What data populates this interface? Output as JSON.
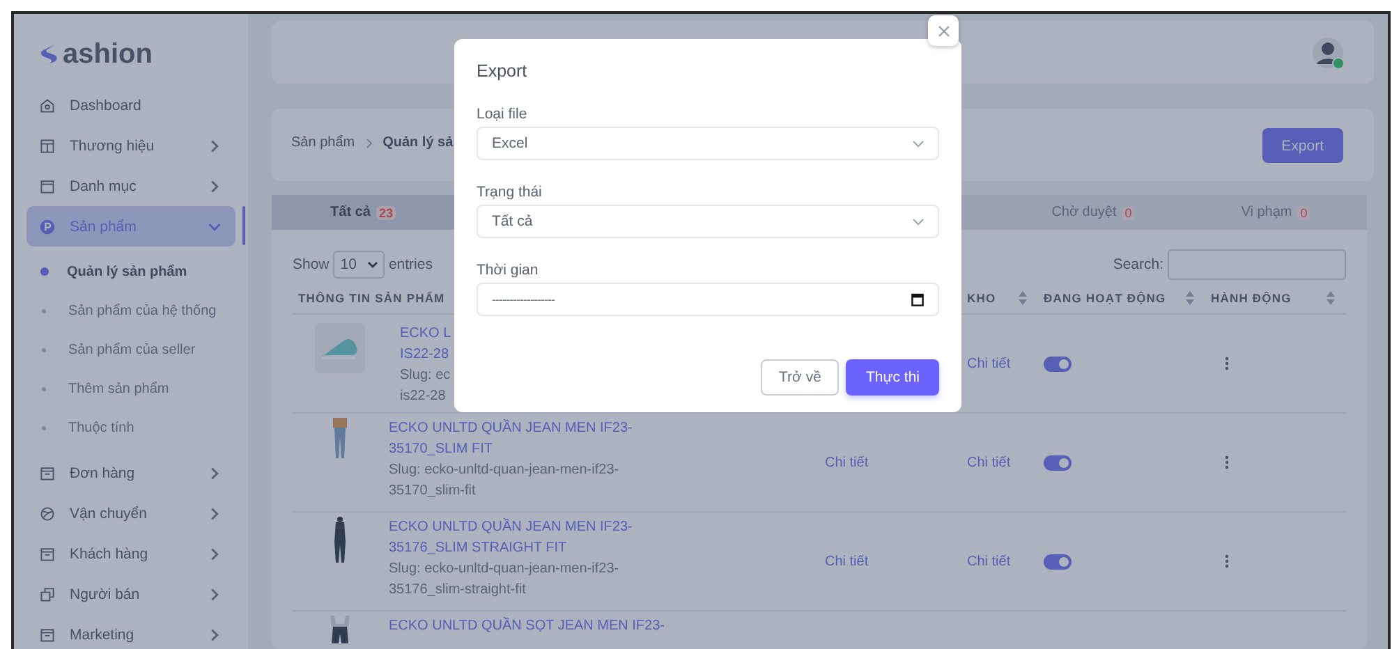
{
  "sidebar": {
    "logo": "ashion",
    "items": [
      {
        "label": "Dashboard",
        "has_submenu": false,
        "expanded": false,
        "selected": false
      },
      {
        "label": "Thương hiệu",
        "has_submenu": true,
        "expanded": false,
        "selected": false
      },
      {
        "label": "Danh mục",
        "has_submenu": true,
        "expanded": false,
        "selected": false
      },
      {
        "label": "Sản phẩm",
        "has_submenu": true,
        "expanded": true,
        "selected": true,
        "children": [
          {
            "label": "Quản lý sản phẩm",
            "selected": true
          },
          {
            "label": "Sản phẩm của hệ thống",
            "selected": false
          },
          {
            "label": "Sản phẩm của seller",
            "selected": false
          },
          {
            "label": "Thêm sản phẩm",
            "selected": false
          },
          {
            "label": "Thuộc tính",
            "selected": false
          }
        ]
      },
      {
        "label": "Đơn hàng",
        "has_submenu": true,
        "expanded": false,
        "selected": false
      },
      {
        "label": "Vận chuyển",
        "has_submenu": true,
        "expanded": false,
        "selected": false
      },
      {
        "label": "Khách hàng",
        "has_submenu": true,
        "expanded": false,
        "selected": false
      },
      {
        "label": "Người bán",
        "has_submenu": true,
        "expanded": false,
        "selected": false
      },
      {
        "label": "Marketing",
        "has_submenu": true,
        "expanded": false,
        "selected": false
      }
    ]
  },
  "breadcrumb": [
    "Sản phẩm",
    "Quản lý sả"
  ],
  "export_button": "Export",
  "tabs": [
    {
      "label": "Tất cả",
      "count": "23",
      "selected": true
    },
    {
      "label": "Chờ duyệt",
      "count": "0",
      "selected": false
    },
    {
      "label": "Vi phạm",
      "count": "0",
      "selected": false
    }
  ],
  "table": {
    "show_label": "Show",
    "page_size": "10",
    "entries_label": "entries",
    "search_label": "Search:",
    "columns": [
      {
        "label": "THÔNG TIN SẢN PHẨM"
      },
      {
        "label": "KHO"
      },
      {
        "label": "ĐANG HOẠT ĐỘNG"
      },
      {
        "label": "HÀNH ĐỘNG"
      }
    ],
    "rows": [
      {
        "title": [
          "ECKO L",
          "IS22-28"
        ],
        "slug": [
          "Slug: ec",
          "is22-28"
        ],
        "stock": "Chi tiết",
        "active": true
      },
      {
        "title": [
          "ECKO UNLTD QUẦN JEAN MEN IF23-",
          "35170_SLIM FIT"
        ],
        "slug": [
          "Slug: ecko-unltd-quan-jean-men-if23-",
          "35170_slim-fit"
        ],
        "detail": "Chi tiết",
        "stock": "Chi tiết",
        "active": true
      },
      {
        "title": [
          "ECKO UNLTD QUẦN JEAN MEN IF23-",
          "35176_SLIM STRAIGHT FIT"
        ],
        "slug": [
          "Slug: ecko-unltd-quan-jean-men-if23-",
          "35176_slim-straight-fit"
        ],
        "detail": "Chi tiết",
        "stock": "Chi tiết",
        "active": true
      },
      {
        "title": [
          "ECKO UNLTD QUẦN SỌT JEAN MEN IF23-"
        ]
      }
    ]
  },
  "modal": {
    "title": "Export",
    "fields": [
      {
        "label": "Loại file",
        "kind": "select",
        "value": "Excel"
      },
      {
        "label": "Trạng thái",
        "kind": "select",
        "value": "Tất cả"
      },
      {
        "label": "Thời gian",
        "kind": "date",
        "value": "------------------"
      }
    ],
    "buttons": [
      {
        "label": "Trở về",
        "kind": "secondary"
      },
      {
        "label": "Thực thi",
        "kind": "primary"
      }
    ]
  }
}
